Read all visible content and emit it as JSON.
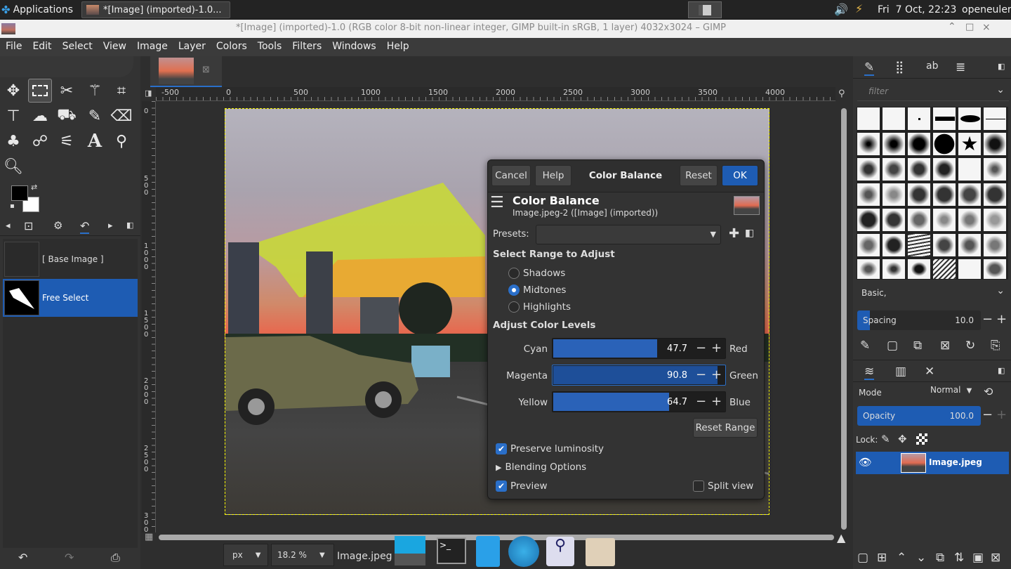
{
  "taskbar": {
    "apps_label": "Applications",
    "window_task": "*[Image] (imported)-1.0...",
    "clock": "Fri  7 Oct, 22:23",
    "user": "openeuler"
  },
  "window": {
    "title": "*[Image] (imported)-1.0 (RGB color 8-bit non-linear integer, GIMP built-in sRGB, 1 layer) 4032x3024 – GIMP"
  },
  "menu": [
    "File",
    "Edit",
    "Select",
    "View",
    "Image",
    "Layer",
    "Colors",
    "Tools",
    "Filters",
    "Windows",
    "Help"
  ],
  "toolbox": {
    "channels": [
      {
        "label": "[ Base Image ]"
      },
      {
        "label": "Free Select"
      }
    ]
  },
  "ruler": {
    "h_ticks": [
      "-500",
      "0",
      "500",
      "1000",
      "1500",
      "2000",
      "2500",
      "3000",
      "3500",
      "4000"
    ],
    "v_ticks": [
      "0",
      "500",
      "1000",
      "1500",
      "2000",
      "2500",
      "3000"
    ]
  },
  "dialog": {
    "cancel": "Cancel",
    "help": "Help",
    "header_title": "Color Balance",
    "reset": "Reset",
    "ok": "OK",
    "title": "Color Balance",
    "subtitle": "Image.jpeg-2 ([Image] (imported))",
    "presets_label": "Presets:",
    "range_label": "Select Range to Adjust",
    "ranges": [
      "Shadows",
      "Midtones",
      "Highlights"
    ],
    "selected_range": "Midtones",
    "levels_label": "Adjust Color Levels",
    "sliders": [
      {
        "left": "Cyan",
        "right": "Red",
        "value": "47.7",
        "fraction": 0.6
      },
      {
        "left": "Magenta",
        "right": "Green",
        "value": "90.8",
        "fraction": 0.95
      },
      {
        "left": "Yellow",
        "right": "Blue",
        "value": "64.7",
        "fraction": 0.67
      }
    ],
    "reset_range": "Reset Range",
    "preserve": "Preserve luminosity",
    "blending": "Blending Options",
    "preview": "Preview",
    "split": "Split view"
  },
  "statusbar": {
    "unit": "px",
    "zoom": "18.2 %",
    "filename": "Image.jpeg"
  },
  "brushes": {
    "filter_placeholder": "filter",
    "tag": "Basic,",
    "spacing_label": "Spacing",
    "spacing_value": "10.0",
    "spacing_fraction": 0.1
  },
  "layers": {
    "mode_label": "Mode",
    "mode_value": "Normal",
    "opacity_label": "Opacity",
    "opacity_value": "100.0",
    "lock_label": "Lock:",
    "layer_name": "Image.jpeg"
  },
  "colors": {
    "accent": "#1e5cb3",
    "dialog_bg": "#333333",
    "fg_color": "#000000",
    "bg_color": "#ffffff"
  }
}
